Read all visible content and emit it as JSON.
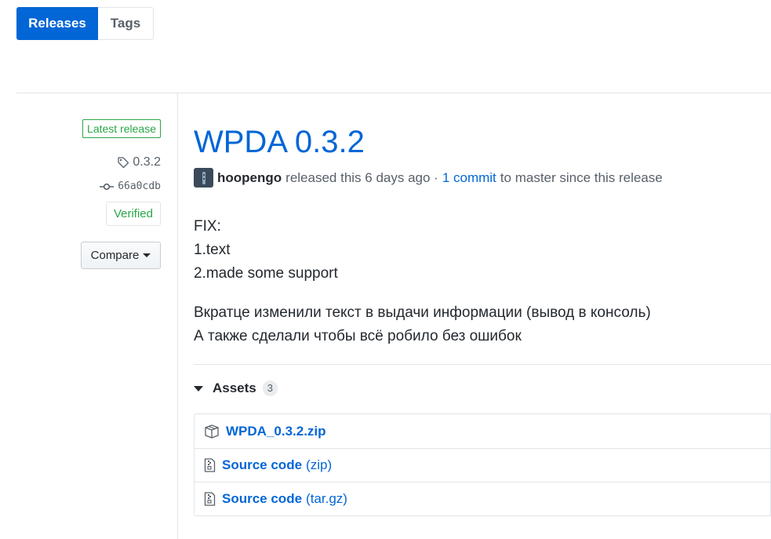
{
  "tabs": {
    "releases": "Releases",
    "tags": "Tags"
  },
  "meta": {
    "latest_badge": "Latest release",
    "tag": "0.3.2",
    "commit": "66a0cdb",
    "verified": "Verified",
    "compare": "Compare"
  },
  "release": {
    "title": "WPDA 0.3.2",
    "author": "hoopengo",
    "released_text": "released this 6 days ago ·",
    "commit_link": "1 commit",
    "since_text": "to master since this release"
  },
  "notes": {
    "line1": "FIX:",
    "line2": "1.text",
    "line3": "2.made some support",
    "line4": "Вкратце изменили текст в выдачи информации (вывод в консоль)",
    "line5": "А также сделали чтобы всё робило без ошибок"
  },
  "assets": {
    "label": "Assets",
    "count": "3",
    "items": [
      {
        "name": "WPDA_0.3.2.zip",
        "suffix": "",
        "icon": "package-icon"
      },
      {
        "name": "Source code",
        "suffix": "(zip)",
        "icon": "file-zip-icon"
      },
      {
        "name": "Source code",
        "suffix": "(tar.gz)",
        "icon": "file-zip-icon"
      }
    ]
  },
  "colors": {
    "accent": "#0366d6",
    "success": "#28a745",
    "border": "#e1e4e8"
  }
}
